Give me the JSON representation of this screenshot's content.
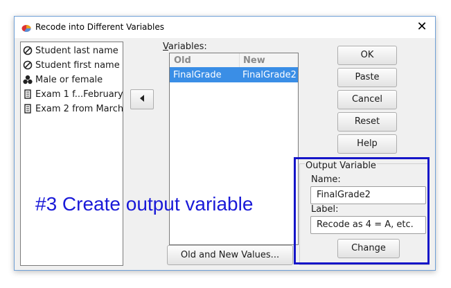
{
  "window": {
    "title": "Recode into Different Variables",
    "close_symbol": "✕"
  },
  "source_variables": [
    {
      "label": "Student last name",
      "icon": "string-variable-icon"
    },
    {
      "label": "Student first name",
      "icon": "string-variable-icon"
    },
    {
      "label": "Male or female",
      "icon": "nominal-variable-icon"
    },
    {
      "label": "Exam 1 f...February",
      "icon": "scale-variable-icon"
    },
    {
      "label": "Exam 2 from March",
      "icon": "scale-variable-icon"
    }
  ],
  "variables_panel": {
    "label_prefix": "",
    "label_mnemonic": "V",
    "label_rest": "ariables:",
    "columns": {
      "old": "Old",
      "new": "New"
    },
    "rows": [
      {
        "old": "FinalGrade",
        "new": "FinalGrade2"
      }
    ]
  },
  "buttons": {
    "ok": "OK",
    "paste": "Paste",
    "cancel": "Cancel",
    "reset": "Reset",
    "help": "Help",
    "old_new_values": "Old and New Values..."
  },
  "output_variable": {
    "group_title": "Output Variable",
    "name_label": "Name:",
    "name_value": "FinalGrade2",
    "label_label": "Label:",
    "label_value": "Recode as 4 = A, etc.",
    "change_button": "Change"
  },
  "annotation": {
    "text": "#3 Create output variable",
    "color": "#1a1ad8",
    "box_color": "#1515c8"
  }
}
